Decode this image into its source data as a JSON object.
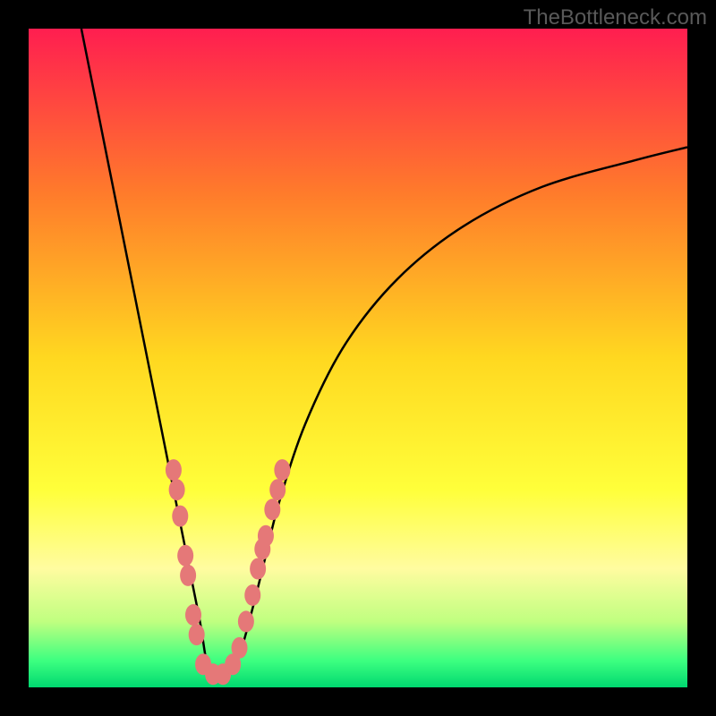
{
  "watermark": "TheBottleneck.com",
  "chart_data": {
    "type": "line",
    "title": "",
    "xlabel": "",
    "ylabel": "",
    "xlim": [
      0,
      100
    ],
    "ylim": [
      0,
      100
    ],
    "gradient_stops": [
      {
        "offset": 0,
        "color": "#ff1e50"
      },
      {
        "offset": 25,
        "color": "#ff7b2b"
      },
      {
        "offset": 50,
        "color": "#ffd820"
      },
      {
        "offset": 70,
        "color": "#ffff3a"
      },
      {
        "offset": 82,
        "color": "#fffca0"
      },
      {
        "offset": 90,
        "color": "#c0ff80"
      },
      {
        "offset": 96,
        "color": "#3cff80"
      },
      {
        "offset": 100,
        "color": "#00d870"
      }
    ],
    "series": [
      {
        "name": "bottleneck-curve",
        "x": [
          8,
          10,
          12,
          14,
          16,
          18,
          20,
          22,
          24,
          26,
          27,
          28,
          30,
          32,
          34,
          36,
          38,
          42,
          48,
          56,
          66,
          78,
          92,
          100
        ],
        "y": [
          100,
          90,
          80,
          70,
          60,
          50,
          40,
          30,
          20,
          10,
          4,
          2,
          2,
          5,
          12,
          20,
          28,
          40,
          52,
          62,
          70,
          76,
          80,
          82
        ]
      }
    ],
    "markers": {
      "name": "highlight-points",
      "color": "#e57878",
      "points": [
        {
          "x": 22.0,
          "y": 33
        },
        {
          "x": 22.5,
          "y": 30
        },
        {
          "x": 23.0,
          "y": 26
        },
        {
          "x": 23.8,
          "y": 20
        },
        {
          "x": 24.2,
          "y": 17
        },
        {
          "x": 25.0,
          "y": 11
        },
        {
          "x": 25.5,
          "y": 8
        },
        {
          "x": 26.5,
          "y": 3.5
        },
        {
          "x": 28.0,
          "y": 2
        },
        {
          "x": 29.5,
          "y": 2
        },
        {
          "x": 31.0,
          "y": 3.5
        },
        {
          "x": 32.0,
          "y": 6
        },
        {
          "x": 33.0,
          "y": 10
        },
        {
          "x": 34.0,
          "y": 14
        },
        {
          "x": 34.8,
          "y": 18
        },
        {
          "x": 35.5,
          "y": 21
        },
        {
          "x": 36.0,
          "y": 23
        },
        {
          "x": 37.0,
          "y": 27
        },
        {
          "x": 37.8,
          "y": 30
        },
        {
          "x": 38.5,
          "y": 33
        }
      ]
    }
  }
}
